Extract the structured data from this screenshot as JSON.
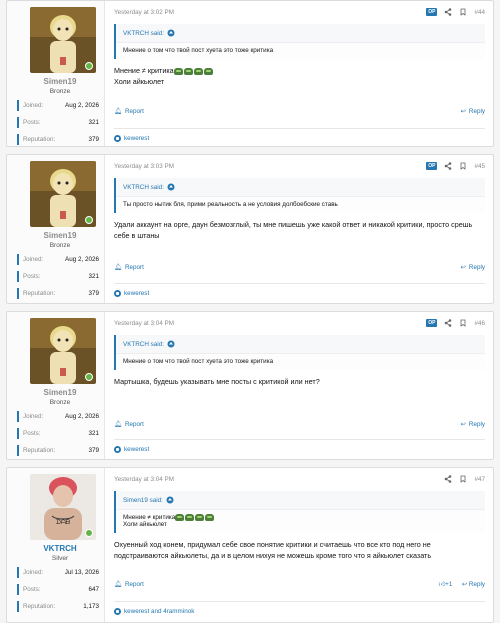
{
  "colors": {
    "accent": "#2577b1",
    "online": "#63b545",
    "op_badge": "#2577b1"
  },
  "posts": [
    {
      "user": {
        "name": "Simen19",
        "title": "Bronze",
        "joined_label": "Joined:",
        "joined": "Aug 2, 2026",
        "posts_label": "Posts:",
        "posts": "321",
        "rep_label": "Reputation:",
        "rep": "379"
      },
      "date": "Yesterday at 3:02 PM",
      "op": "OP",
      "number": "#44",
      "quote_author": "VKTRCH said:",
      "quote_text": "Мнение о том что твой пост хуета это тоже критика",
      "lines": [
        "Мнение ≠ критика",
        "Холи айкьюлет"
      ],
      "report": "Report",
      "reply": "Reply",
      "reactions": "kewerest"
    },
    {
      "user": {
        "name": "Simen19",
        "title": "Bronze",
        "joined_label": "Joined:",
        "joined": "Aug 2, 2026",
        "posts_label": "Posts:",
        "posts": "321",
        "rep_label": "Reputation:",
        "rep": "379"
      },
      "date": "Yesterday at 3:03 PM",
      "op": "OP",
      "number": "#45",
      "quote_author": "VKTRCH said:",
      "quote_text": "Ты просто нытик бля, прими реальность а не условия долбоебские ставь",
      "lines": [
        "Удали аккаунт на орге, даун безмозглый, ты мне пишешь уже какой ответ и никакой критики, просто срешь себе в штаны"
      ],
      "report": "Report",
      "reply": "Reply",
      "reactions": "kewerest"
    },
    {
      "user": {
        "name": "Simen19",
        "title": "Bronze",
        "joined_label": "Joined:",
        "joined": "Aug 2, 2026",
        "posts_label": "Posts:",
        "posts": "321",
        "rep_label": "Reputation:",
        "rep": "379"
      },
      "date": "Yesterday at 3:04 PM",
      "op": "OP",
      "number": "#46",
      "quote_author": "VKTRCH said:",
      "quote_text": "Мнение о том что твой пост хуета это тоже критика",
      "lines": [
        "Мартышка, будешь указывать мне посты с критикой или нет?"
      ],
      "report": "Report",
      "reply": "Reply",
      "reactions": "kewerest"
    },
    {
      "user": {
        "name": "VKTRCH",
        "title": "Silver",
        "joined_label": "Joined:",
        "joined": "Jul 13, 2026",
        "posts_label": "Posts:",
        "posts": "647",
        "rep_label": "Reputation:",
        "rep": "1,173"
      },
      "date": "Yesterday at 3:04 PM",
      "number": "#47",
      "quote_author": "Simen19 said:",
      "quote_lines": [
        "Мнение ≠ критика",
        "Холи айкьюлет"
      ],
      "lines": [
        "Охуенный ход конем, придумал себе свое понятие критики и считаешь что все кто под него не подстраиваются айкьюлеты, да и в целом нихуя не можешь кроме того что я айкьюлет сказать"
      ],
      "report": "Report",
      "reply": "Reply",
      "plus": "+1",
      "reactions": "kewerest and 4ramminok"
    }
  ]
}
